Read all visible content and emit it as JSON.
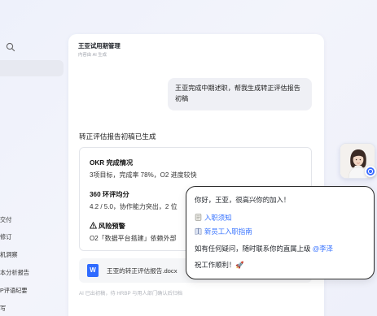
{
  "sidebar": {
    "items": [
      {
        "label": "交付",
        "id": "deliver"
      },
      {
        "label": "修订",
        "id": "revise"
      },
      {
        "label": "机洞察",
        "id": "insight"
      },
      {
        "label": "本分析报告",
        "id": "report"
      },
      {
        "label": "P评语纪要",
        "id": "minutes"
      },
      {
        "label": "写",
        "id": "write"
      }
    ]
  },
  "chat": {
    "title": "王亚试用期管理",
    "subtitle": "内容由 AI 生成",
    "user_message": "王亚完成中期述职，帮我生成转正评估报告初稿",
    "bot_heading": "转正评估报告初稿已生成",
    "report": {
      "s1_title": "OKR 完成情况",
      "s1_text": "3项目标，完成率 78%，O2 进度较快",
      "s2_title": "360 环评均分",
      "s2_text": "4.2 / 5.0，协作能力突出，2 位",
      "s3_title": "风险预警",
      "s3_text": "O2「数据平台搭建」依赖外部"
    },
    "doc": {
      "icon_letter": "W",
      "name": "王亚的转正评估报告.docx"
    },
    "footnote": "AI 已出初稿，待 HRBP 与用人部门确认后归档"
  },
  "popup": {
    "greeting": "你好，王亚，很高兴你的加入！",
    "link1": "入职须知",
    "link2": "新员工入职指南",
    "contact_prefix": "如有任何疑问，随时联系你的直属上级",
    "contact_mention": "@李泽",
    "wish": "祝工作顺利！🚀"
  },
  "colors": {
    "accent": "#3370ff",
    "doc_icon": "#2f6bff",
    "bubble": "#eff0f5",
    "background": "#eef1fb"
  }
}
